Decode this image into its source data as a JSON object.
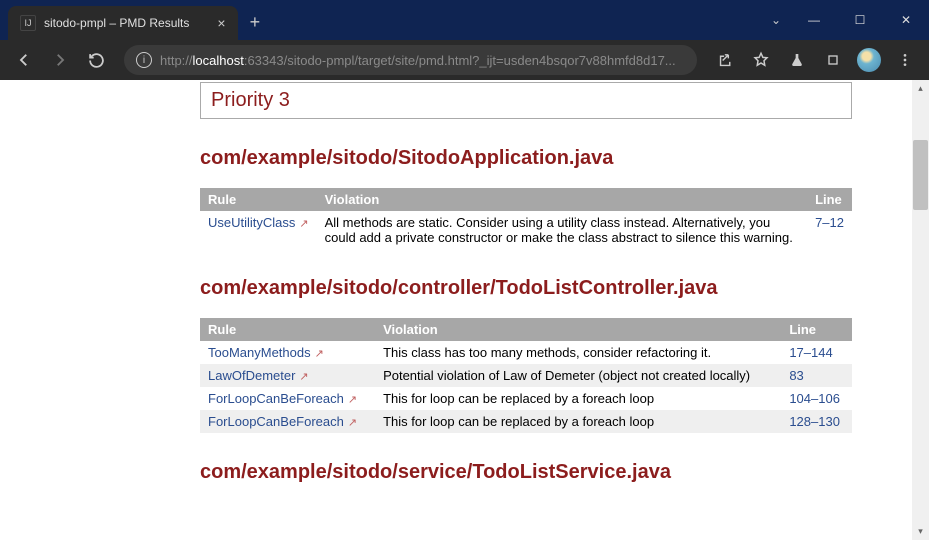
{
  "browser": {
    "tab_title": "sitodo-pmpl – PMD Results",
    "url_prefix": "http://",
    "url_host": "localhost",
    "url_rest": ":63343/sitodo-pmpl/target/site/pmd.html?_ijt=usden4bsqor7v88hmfd8d17..."
  },
  "page": {
    "priority_label": "Priority 3",
    "columns": {
      "rule": "Rule",
      "violation": "Violation",
      "line": "Line"
    },
    "sections": [
      {
        "file": "com/example/sitodo/SitodoApplication.java",
        "rows": [
          {
            "rule": "UseUtilityClass",
            "violation": "All methods are static. Consider using a utility class instead. Alternatively, you could add a private constructor or make the class abstract to silence this warning.",
            "line_from": "7",
            "line_to": "12"
          }
        ]
      },
      {
        "file": "com/example/sitodo/controller/TodoListController.java",
        "rows": [
          {
            "rule": "TooManyMethods",
            "violation": "This class has too many methods, consider refactoring it.",
            "line_from": "17",
            "line_to": "144"
          },
          {
            "rule": "LawOfDemeter",
            "violation": "Potential violation of Law of Demeter (object not created locally)",
            "line_from": "83",
            "line_to": ""
          },
          {
            "rule": "ForLoopCanBeForeach",
            "violation": "This for loop can be replaced by a foreach loop",
            "line_from": "104",
            "line_to": "106"
          },
          {
            "rule": "ForLoopCanBeForeach",
            "violation": "This for loop can be replaced by a foreach loop",
            "line_from": "128",
            "line_to": "130"
          }
        ]
      },
      {
        "file": "com/example/sitodo/service/TodoListService.java",
        "rows": []
      }
    ]
  }
}
